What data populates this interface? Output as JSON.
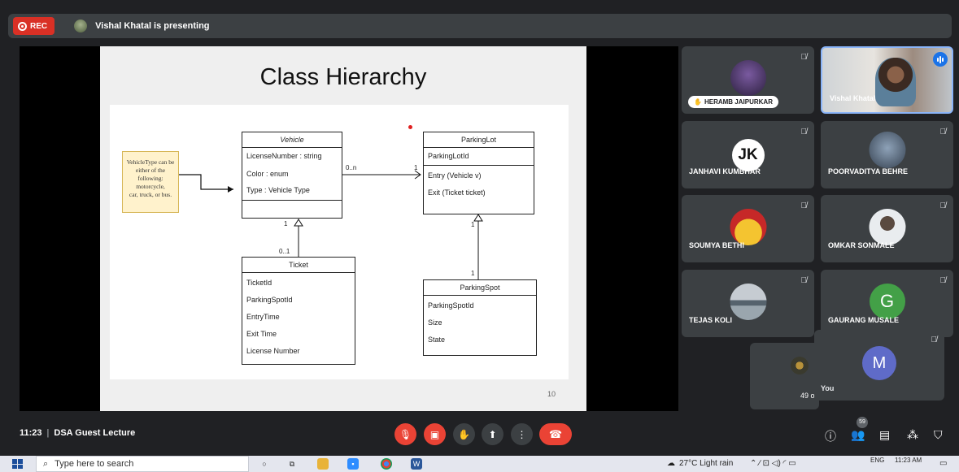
{
  "topbar": {
    "rec_label": "REC",
    "presenting_text": "Vishal Khatal is presenting"
  },
  "slide": {
    "title": "Class Hierarchy",
    "page_number": "10",
    "note": [
      "VehicleType can be",
      "either of the",
      "following: motorcycle,",
      "car, truck, or bus."
    ],
    "vehicle": {
      "name": "Vehicle",
      "attributes": [
        "LicenseNumber : string",
        "Color : enum",
        "Type : Vehicle Type"
      ]
    },
    "parking_lot": {
      "name": "ParkingLot",
      "attributes": [
        "ParkingLotId"
      ],
      "methods": [
        "Entry (Vehicle v)",
        "Exit (Ticket ticket)"
      ]
    },
    "ticket": {
      "name": "Ticket",
      "attributes": [
        "TicketId",
        "ParkingSpotId",
        "EntryTime",
        "Exit Time",
        "License Number"
      ]
    },
    "parking_spot": {
      "name": "ParkingSpot",
      "attributes": [
        "ParkingSpotId",
        "Size",
        "State"
      ]
    },
    "multiplicities": {
      "vehicle_lot_left": "0..n",
      "vehicle_lot_right": "1",
      "vehicle_ticket_top": "1",
      "vehicle_ticket_bottom": "0..1",
      "lot_spot_top": "1",
      "lot_spot_bottom": "1"
    }
  },
  "participants": [
    {
      "name": "HERAMB JAIPURKAR",
      "hand_raised": true,
      "avatar_color": "#4a3b6b"
    },
    {
      "name": "Vishal Khatal",
      "speaking": true
    },
    {
      "name": "JANHAVI KUMBHAR",
      "avatar_text": "JK",
      "avatar_color": "#ffffff"
    },
    {
      "name": "POORVADITYA BEHRE",
      "avatar_color": "#6d7f9a"
    },
    {
      "name": "SOUMYA BETHI",
      "avatar_color": "#c0392b"
    },
    {
      "name": "OMKAR SONMALE",
      "avatar_color": "#d8dde2"
    },
    {
      "name": "TEJAS KOLI",
      "avatar_color": "#7f8c8d"
    },
    {
      "name": "GAURANG MUSALE",
      "avatar_text": "G",
      "avatar_color": "#43a047"
    }
  ],
  "others": {
    "count": "49 o"
  },
  "self": {
    "name": "You",
    "avatar_text": "M",
    "avatar_color": "#5f6bc8"
  },
  "controls": {
    "time": "11:23",
    "meeting_title": "DSA Guest Lecture",
    "participant_count": "59"
  },
  "taskbar": {
    "search_placeholder": "Type here to search",
    "weather": "27°C  Light rain",
    "language": "ENG",
    "time": "11:23 AM"
  }
}
